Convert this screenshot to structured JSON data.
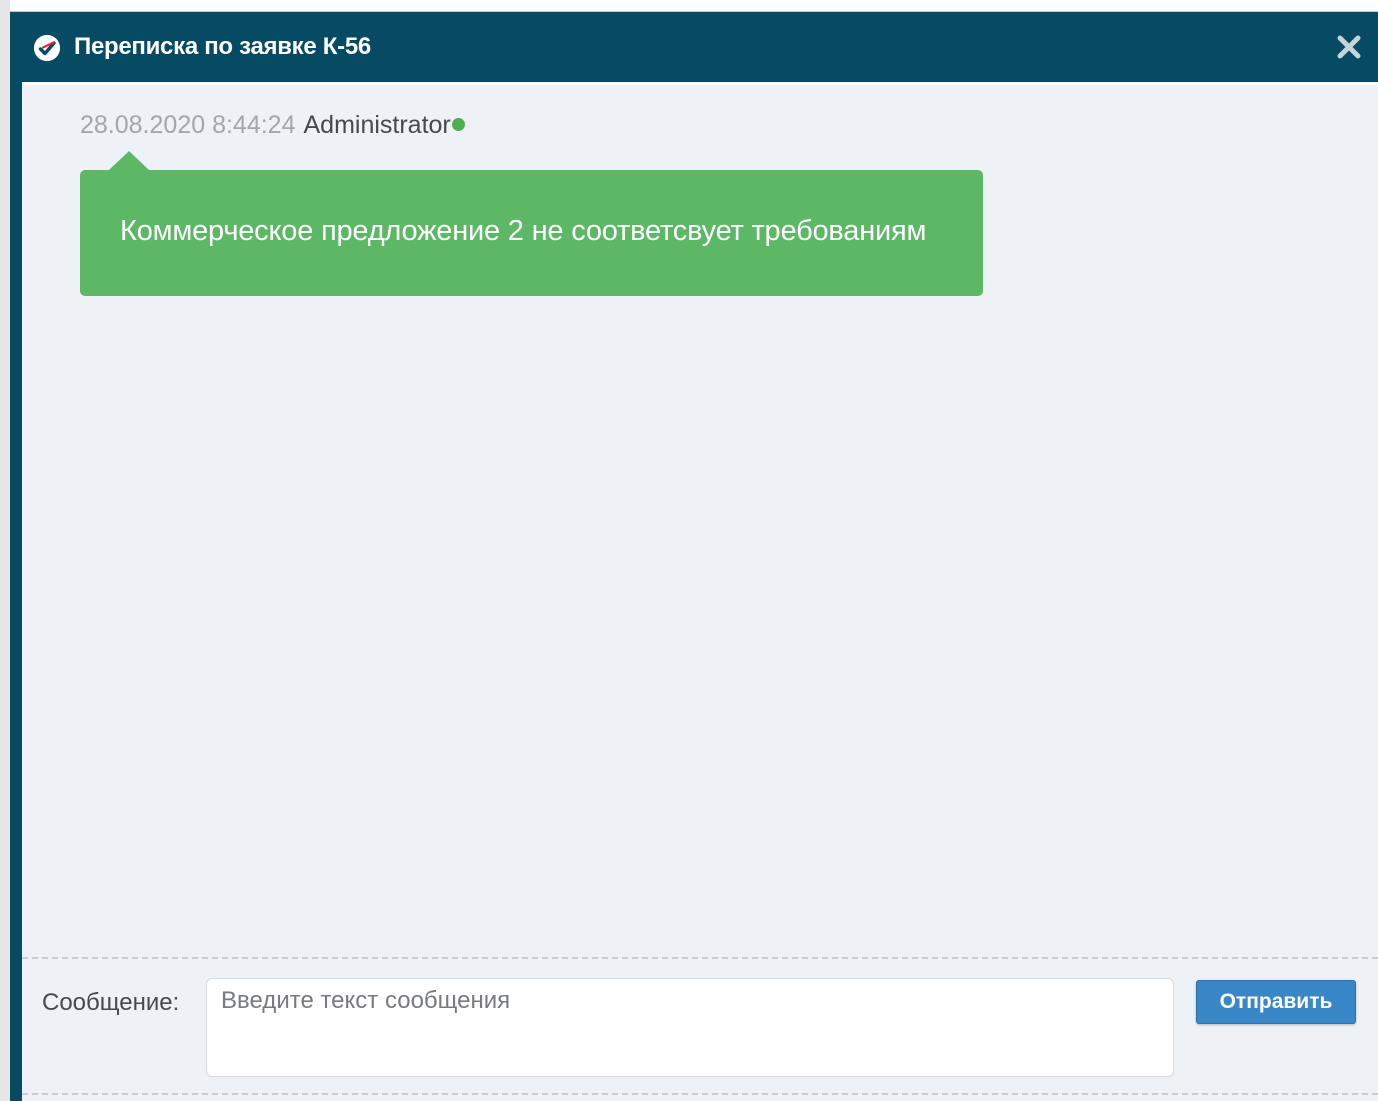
{
  "dialog": {
    "title": "Переписка по заявке К-56",
    "title_icon": "checkmark-circle-icon",
    "close_icon": "close-icon"
  },
  "messages": [
    {
      "timestamp": "28.08.2020 8:44:24",
      "author": "Administrator",
      "online": true,
      "text": "Коммерческое предложение 2 не соответсвует требованиям"
    }
  ],
  "composer": {
    "label": "Сообщение:",
    "placeholder": "Введите текст сообщения",
    "value": "",
    "send_label": "Отправить"
  },
  "colors": {
    "header": "#064a64",
    "bubble": "#5cb864",
    "online": "#4caf50",
    "send_button": "#3a87c8",
    "content_bg": "#eef1f6"
  }
}
